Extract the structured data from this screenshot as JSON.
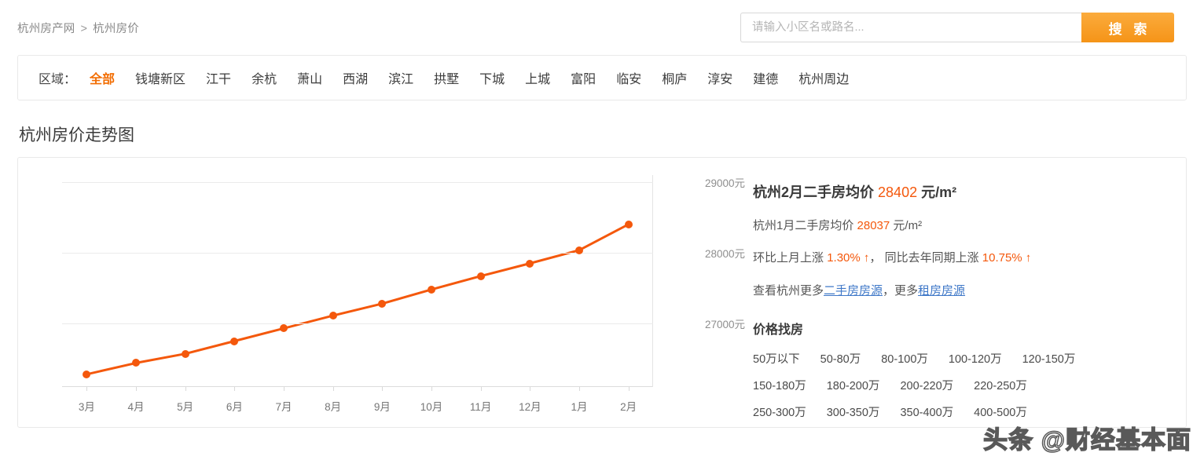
{
  "header": {
    "breadcrumb": {
      "root": "杭州房产网",
      "separator": ">",
      "current": "杭州房价"
    },
    "search": {
      "placeholder": "请输入小区名或路名...",
      "value": "",
      "button_label": "搜 索"
    }
  },
  "filter": {
    "label": "区域：",
    "regions": [
      {
        "label": "全部",
        "active": true
      },
      {
        "label": "钱塘新区",
        "active": false
      },
      {
        "label": "江干",
        "active": false
      },
      {
        "label": "余杭",
        "active": false
      },
      {
        "label": "萧山",
        "active": false
      },
      {
        "label": "西湖",
        "active": false
      },
      {
        "label": "滨江",
        "active": false
      },
      {
        "label": "拱墅",
        "active": false
      },
      {
        "label": "下城",
        "active": false
      },
      {
        "label": "上城",
        "active": false
      },
      {
        "label": "富阳",
        "active": false
      },
      {
        "label": "临安",
        "active": false
      },
      {
        "label": "桐庐",
        "active": false
      },
      {
        "label": "淳安",
        "active": false
      },
      {
        "label": "建德",
        "active": false
      },
      {
        "label": "杭州周边",
        "active": false
      }
    ]
  },
  "page_title": "杭州房价走势图",
  "info": {
    "current_prefix": "杭州2月二手房均价",
    "current_value": "28402",
    "current_unit": "元/m²",
    "previous_prefix": "杭州1月二手房均价",
    "previous_value": "28037",
    "previous_unit": "元/m²",
    "mom_prefix": "环比上月上涨",
    "mom_value": "1.30% ↑",
    "mom_sep": "，",
    "yoy_prefix": "同比去年同期上涨",
    "yoy_value": "10.75% ↑",
    "more_prefix": "查看杭州更多",
    "more_link1": "二手房房源",
    "more_mid": "，更多",
    "more_link2": "租房房源",
    "price_title": "价格找房",
    "price_ranges": [
      [
        "50万以下",
        "50-80万",
        "80-100万",
        "100-120万",
        "120-150万"
      ],
      [
        "150-180万",
        "180-200万",
        "200-220万",
        "220-250万"
      ],
      [
        "250-300万",
        "300-350万",
        "350-400万",
        "400-500万"
      ]
    ]
  },
  "watermark": "头条 @财经基本面",
  "colors": {
    "accent": "#f4580c",
    "button": "#f59418",
    "link": "#3f78c8",
    "gridline": "#ebebeb"
  },
  "chart_data": {
    "type": "line",
    "title": "杭州房价走势图",
    "xlabel": "",
    "ylabel": "元",
    "categories": [
      "3月",
      "4月",
      "5月",
      "6月",
      "7月",
      "8月",
      "9月",
      "10月",
      "11月",
      "12月",
      "1月",
      "2月"
    ],
    "values": [
      26280,
      26440,
      26570,
      26750,
      26930,
      27110,
      27280,
      27480,
      27670,
      27850,
      28037,
      28402
    ],
    "ytick_labels": [
      "29000元",
      "28000元",
      "27000元"
    ],
    "yticks": [
      29000,
      28000,
      27000
    ],
    "ylim": [
      26100,
      29100
    ],
    "grid": true,
    "legend": false,
    "series_color": "#f4580c",
    "unit": "元"
  }
}
